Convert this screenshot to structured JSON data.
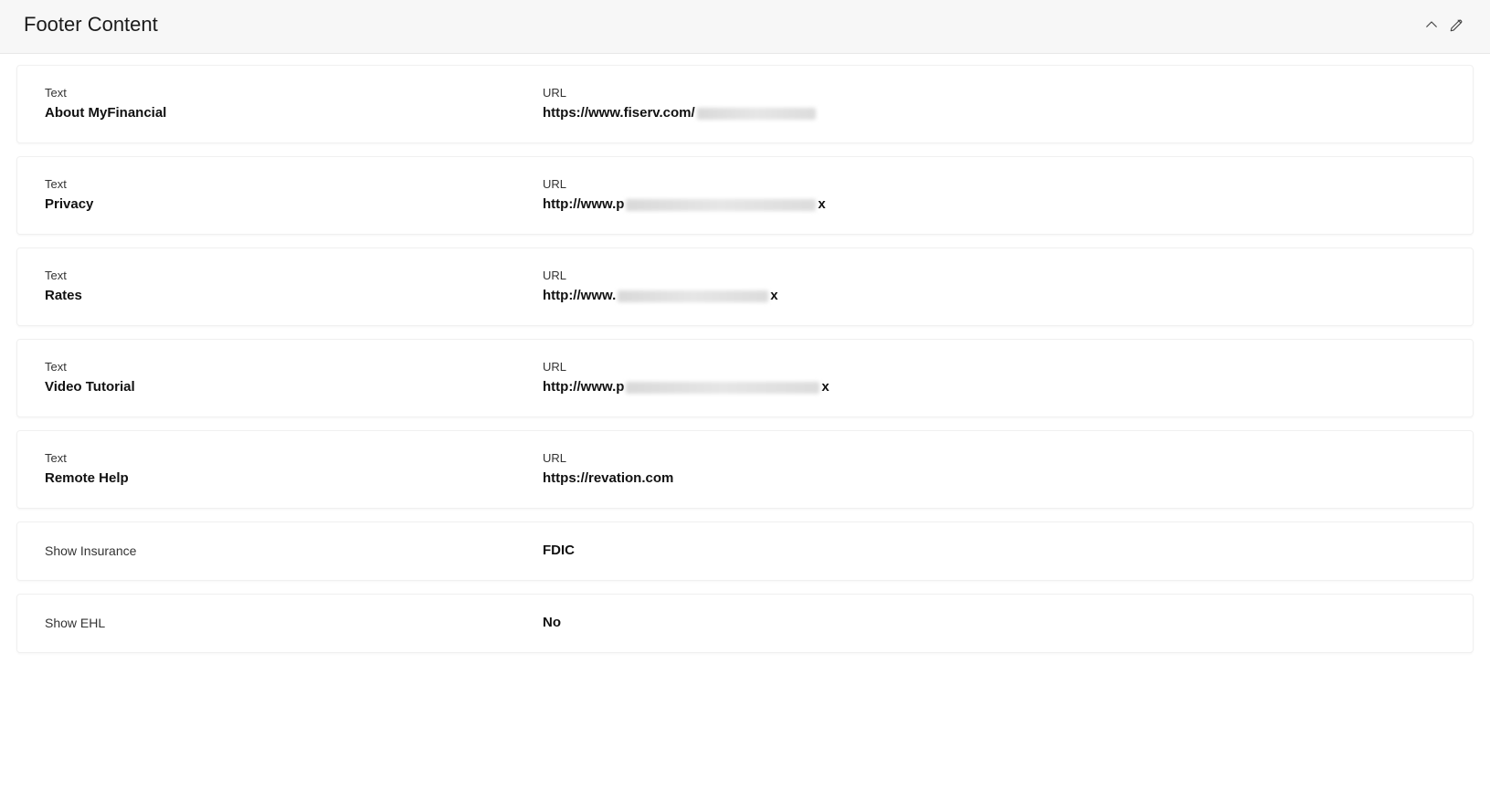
{
  "header": {
    "title": "Footer Content"
  },
  "rows": [
    {
      "text_label": "Text",
      "text_value": "About MyFinancial",
      "url_label": "URL",
      "url_prefix": "https://www.fiserv.com/",
      "url_suffix": "",
      "blur_width": 130
    },
    {
      "text_label": "Text",
      "text_value": "Privacy",
      "url_label": "URL",
      "url_prefix": "http://www.p",
      "url_suffix": "x",
      "blur_width": 208
    },
    {
      "text_label": "Text",
      "text_value": "Rates",
      "url_label": "URL",
      "url_prefix": "http://www.",
      "url_suffix": "x",
      "blur_width": 165
    },
    {
      "text_label": "Text",
      "text_value": "Video Tutorial",
      "url_label": "URL",
      "url_prefix": "http://www.p",
      "url_suffix": "x",
      "blur_width": 212
    },
    {
      "text_label": "Text",
      "text_value": "Remote Help",
      "url_label": "URL",
      "url_prefix": "https://revation.com",
      "url_suffix": "",
      "blur_width": 0
    }
  ],
  "simple": [
    {
      "label": "Show Insurance",
      "value": "FDIC"
    },
    {
      "label": "Show EHL",
      "value": "No"
    }
  ]
}
